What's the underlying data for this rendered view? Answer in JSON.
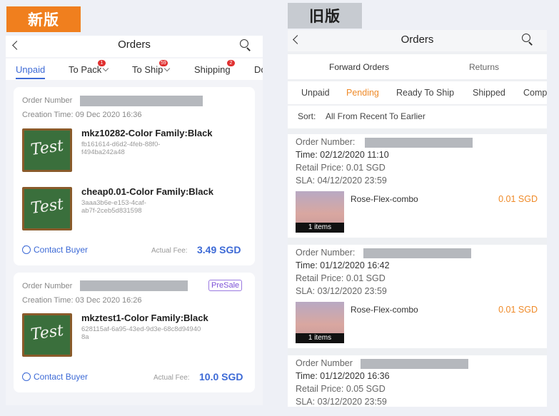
{
  "labels": {
    "new_version": "新版",
    "old_version": "旧版"
  },
  "new_app": {
    "title": "Orders",
    "tabs": [
      {
        "label": "Unpaid",
        "badge": ""
      },
      {
        "label": "To Pack",
        "badge": "1"
      },
      {
        "label": "To Ship",
        "badge": "59"
      },
      {
        "label": "Shipping",
        "badge": "2"
      },
      {
        "label": "Do",
        "badge": ""
      }
    ],
    "orders": [
      {
        "order_label": "Order Number",
        "creation": "Creation Time: 09 Dec 2020 16:36",
        "presale": "",
        "products": [
          {
            "name": "mkz10282-Color Family:Black",
            "id": "fb161614-d6d2-4feb-88f0-\nf494ba242a48",
            "thumb": "Test"
          },
          {
            "name": "cheap0.01-Color Family:Black",
            "id": "3aaa3b6e-e153-4caf-\nab7f-2ceb5d831598",
            "thumb": "Test"
          }
        ],
        "contact": "Contact Buyer",
        "fee_label": "Actual Fee:",
        "fee": "3.49 SGD"
      },
      {
        "order_label": "Order Number",
        "creation": "Creation Time: 03 Dec 2020 16:26",
        "presale": "PreSale",
        "products": [
          {
            "name": "mkztest1-Color Family:Black",
            "id": "628115af-6a95-43ed-9d3e-68c8d94940\n8a",
            "thumb": "Test"
          }
        ],
        "contact": "Contact Buyer",
        "fee_label": "Actual Fee:",
        "fee": "10.0 SGD"
      }
    ]
  },
  "old_app": {
    "title": "Orders",
    "subtabs": [
      "Forward Orders",
      "Returns"
    ],
    "status_tabs": [
      "Unpaid",
      "Pending",
      "Ready To Ship",
      "Shipped",
      "Comp"
    ],
    "sort_label": "Sort:",
    "sort_value": "All From Recent To Earlier",
    "orders": [
      {
        "order_label": "Order Number:",
        "time": "Time: 02/12/2020 11:10",
        "retail": "Retail Price: 0.01 SGD",
        "sla": "SLA: 04/12/2020 23:59",
        "items": "1 items",
        "product": "Rose-Flex-combo",
        "price": "0.01 SGD"
      },
      {
        "order_label": "Order Number:",
        "time": "Time: 01/12/2020 16:42",
        "retail": "Retail Price: 0.01 SGD",
        "sla": "SLA: 03/12/2020 23:59",
        "items": "1 items",
        "product": "Rose-Flex-combo",
        "price": "0.01 SGD"
      },
      {
        "order_label": "Order Number",
        "time": "Time: 01/12/2020 16:36",
        "retail": "Retail Price: 0.05 SGD",
        "sla": "SLA: 03/12/2020 23:59"
      }
    ]
  },
  "colors": {
    "accent_blue": "#3d6ad6",
    "accent_orange": "#ef8a28",
    "badge_red": "#e03030",
    "new_tag": "#f07f1e",
    "old_tag": "#c7cbd1"
  }
}
